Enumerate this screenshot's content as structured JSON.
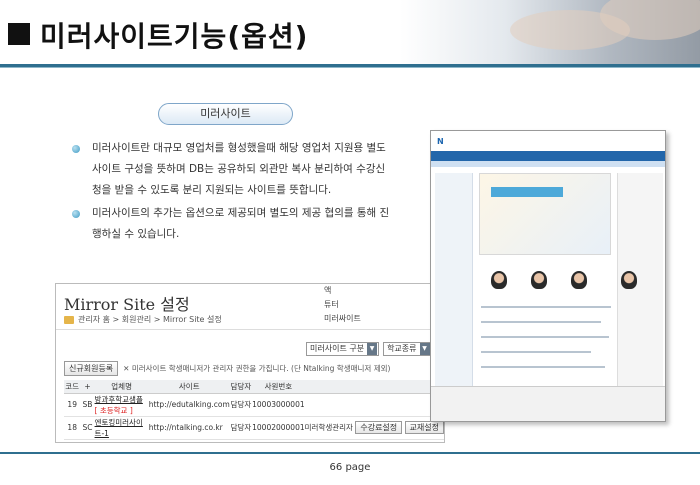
{
  "header": {
    "title": "미러사이트기능(옵션)"
  },
  "section": {
    "pill_label": "미러사이트",
    "bullets": [
      "미러사이트란 대규모 영업처를 형성했을때 해당 영업처 지원용 별도 사이트 구성을 뜻하며 DB는 공유하되 외관만 복사 분리하여 수강신청을 받을 수 있도록 분리 지원되는 사이트를 뜻합니다.",
      "미러사이트의 추가는 옵션으로 제공되며 별도의 제공 협의를 통해 진행하실 수 있습니다."
    ]
  },
  "admin_panel": {
    "title": "Mirror Site 설정",
    "breadcrumb": "관리자 홈 > 회원관리 > Mirror Site 설정",
    "side_menu": [
      "액",
      "튜터",
      "미러싸이트"
    ],
    "filter_select": "미러사이트 구분",
    "school_select": "학교종류",
    "new_member_button": "신규회원등록",
    "notice": "✕ 미러사이트 학생매니저가 관리자 권한을 가집니다. (단 Ntalking 학생매니저 제외)",
    "columns": [
      "코드",
      "+",
      "업체명",
      "사이트",
      "담당자",
      "사원번호",
      ""
    ],
    "rows": [
      {
        "code": "19",
        "type": "SB",
        "name": "방과후학교샘플",
        "tag": "[ 초등학교 ]",
        "site": "http://edutalking.com",
        "manager": "담당자",
        "emp_no": "10003000001",
        "action": "",
        "btn1": "",
        "btn2": ""
      },
      {
        "code": "18",
        "type": "SC",
        "name": "엔토킹미러사이트-1",
        "tag": "",
        "site": "http://ntalking.co.kr",
        "manager": "담당자",
        "emp_no": "10002000001",
        "action": "미러학생관리자",
        "btn1": "수강료설정",
        "btn2": "교재설정"
      }
    ]
  },
  "footer": {
    "page_label": "66 page"
  },
  "colors": {
    "rule": "#2f6f8f",
    "bullet": "#3e9ac4",
    "tag": "#dd2222",
    "site_nav": "#2266aa"
  }
}
